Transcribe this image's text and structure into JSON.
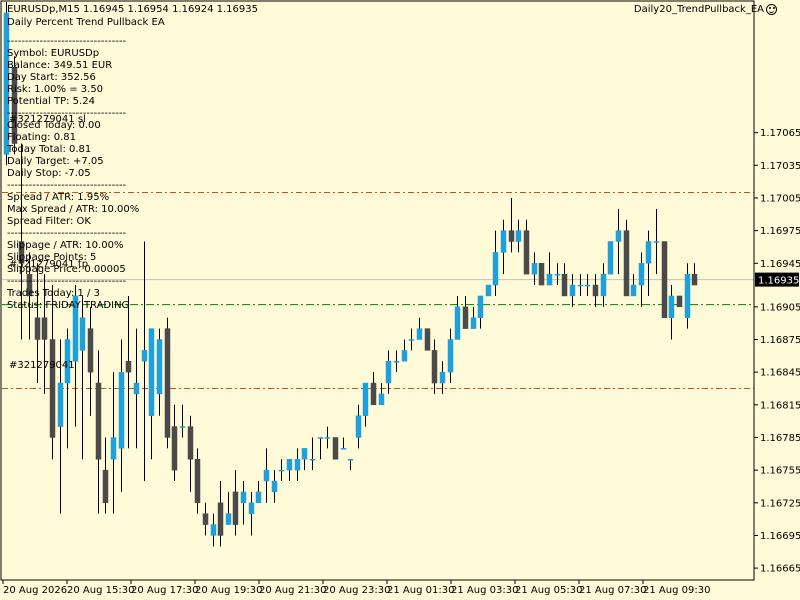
{
  "header": {
    "symbol_line": "EURUSDp,M15  1.16945 1.16954 1.16924 1.16935",
    "ea_title": "Daily Percent Trend Pullback EA"
  },
  "expert": {
    "name": "Daily20_TrendPullback_EA",
    "status_icon": "smiley-icon"
  },
  "panel": {
    "separator": "---------------------------------",
    "group1": [
      "Symbol: EURUSDp",
      "Balance: 349.51 EUR",
      "Day Start: 352.56",
      "Risk: 1.00% = 3.50",
      "Potential TP: 5.24"
    ],
    "group2": [
      "Closed Today: 0.00",
      "Floating: 0.81",
      "Today Total: 0.81",
      "Daily Target: +7.05",
      "Daily Stop: -7.05"
    ],
    "group3": [
      "Spread / ATR: 1.95%",
      "Max Spread / ATR: 10.00%",
      "Spread Filter: OK"
    ],
    "group4": [
      "Slippage / ATR: 10.00%",
      "Slippage Points: 5",
      "Slippage Price: 0.00005"
    ],
    "group5": [
      "Trades Today: 1 / 3",
      "Status: FRIDAY TRADING"
    ]
  },
  "overlays": {
    "ticket_upper": "#321279041 sl",
    "ticket_lower": "#321279041",
    "ticket_mid": "#321279041 tp"
  },
  "colors": {
    "background": "#fffbd8",
    "bull": "#1ea0dc",
    "bear": "#4a4a4a",
    "grid_price_line": "#c0c0c0",
    "stop_line": "#c8501e",
    "entry_line": "#008000",
    "current_price_bg": "#000000"
  },
  "chart_data": {
    "type": "candlestick",
    "symbol": "EURUSDp",
    "timeframe": "M15",
    "ylim": [
      1.1666,
      1.1719
    ],
    "yticks": [
      "1.17065",
      "1.17035",
      "1.17005",
      "1.16975",
      "1.16945",
      "1.16905",
      "1.16875",
      "1.16845",
      "1.16815",
      "1.16785",
      "1.16755",
      "1.16725",
      "1.16695",
      "1.16665"
    ],
    "ytick_values": [
      1.1707,
      1.1704,
      1.1701,
      1.1698,
      1.1695,
      1.1691,
      1.1688,
      1.1685,
      1.1682,
      1.1679,
      1.1676,
      1.1673,
      1.167,
      1.1667
    ],
    "xticks": [
      "20 Aug 2026",
      "20 Aug 15:30",
      "20 Aug 17:30",
      "20 Aug 19:30",
      "20 Aug 21:30",
      "20 Aug 23:30",
      "21 Aug 01:30",
      "21 Aug 03:30",
      "21 Aug 05:30",
      "21 Aug 07:30",
      "21 Aug 09:30"
    ],
    "current_price": "1.16935",
    "current_price_value": 1.16935,
    "levels": {
      "stop_upper": 1.17015,
      "stop_lower": 1.16835,
      "entry": 1.16912,
      "current": 1.16935
    },
    "candles": [
      [
        1.1705,
        1.1719,
        1.1704,
        1.1718
      ],
      [
        1.1713,
        1.1714,
        1.1705,
        1.1706
      ],
      [
        1.1697,
        1.1706,
        1.1688,
        1.1695
      ],
      [
        1.1694,
        1.1696,
        1.1688,
        1.1692
      ],
      [
        1.169,
        1.1695,
        1.1684,
        1.1688
      ],
      [
        1.169,
        1.1694,
        1.1683,
        1.1688
      ],
      [
        1.1688,
        1.1693,
        1.1677,
        1.1679
      ],
      [
        1.168,
        1.1688,
        1.1672,
        1.1684
      ],
      [
        1.1684,
        1.1689,
        1.1678,
        1.1688
      ],
      [
        1.1686,
        1.1693,
        1.168,
        1.1692
      ],
      [
        1.1687,
        1.1692,
        1.1677,
        1.169
      ],
      [
        1.1689,
        1.1691,
        1.1681,
        1.1685
      ],
      [
        1.1684,
        1.1687,
        1.1672,
        1.1677
      ],
      [
        1.1676,
        1.1679,
        1.1672,
        1.1673
      ],
      [
        1.1677,
        1.1685,
        1.1672,
        1.1679
      ],
      [
        1.1678,
        1.1688,
        1.1674,
        1.1685
      ],
      [
        1.1686,
        1.1692,
        1.1678,
        1.1685
      ],
      [
        1.1683,
        1.1689,
        1.1678,
        1.1684
      ],
      [
        1.1686,
        1.1697,
        1.1675,
        1.1687
      ],
      [
        1.1681,
        1.1689,
        1.1677,
        1.1689
      ],
      [
        1.1683,
        1.1689,
        1.1681,
        1.1688
      ],
      [
        1.1689,
        1.169,
        1.1678,
        1.1679
      ],
      [
        1.168,
        1.1682,
        1.1675,
        1.1676
      ],
      [
        1.168,
        1.1682,
        1.1679,
        1.168
      ],
      [
        1.168,
        1.1681,
        1.1674,
        1.1677
      ],
      [
        1.1677,
        1.1678,
        1.1672,
        1.1673
      ],
      [
        1.1672,
        1.1673,
        1.167,
        1.1671
      ],
      [
        1.167,
        1.1672,
        1.1669,
        1.1671
      ],
      [
        1.1673,
        1.1675,
        1.1669,
        1.167
      ],
      [
        1.1671,
        1.1674,
        1.1671,
        1.1672
      ],
      [
        1.1674,
        1.1676,
        1.167,
        1.1671
      ],
      [
        1.1673,
        1.1675,
        1.1671,
        1.1674
      ],
      [
        1.1672,
        1.1674,
        1.167,
        1.1673
      ],
      [
        1.1673,
        1.1675,
        1.1673,
        1.1674
      ],
      [
        1.1675,
        1.1678,
        1.1673,
        1.1676
      ],
      [
        1.1674,
        1.1676,
        1.1673,
        1.1675
      ],
      [
        1.1676,
        1.1677,
        1.1675,
        1.1676
      ],
      [
        1.1676,
        1.1677,
        1.1675,
        1.1677
      ],
      [
        1.1676,
        1.1678,
        1.1675,
        1.1677
      ],
      [
        1.1677,
        1.1678,
        1.1676,
        1.1678
      ],
      [
        1.1677,
        1.1679,
        1.1676,
        1.1677
      ],
      [
        1.1679,
        1.1679,
        1.1677,
        1.1679
      ],
      [
        1.1679,
        1.168,
        1.1678,
        1.1679
      ],
      [
        1.1679,
        1.1679,
        1.1677,
        1.1677
      ],
      [
        1.1678,
        1.1679,
        1.1678,
        1.1678
      ],
      [
        1.1677,
        1.1677,
        1.1676,
        1.1677
      ],
      [
        1.1679,
        1.1682,
        1.1678,
        1.1681
      ],
      [
        1.1681,
        1.1684,
        1.168,
        1.1684
      ],
      [
        1.1684,
        1.1685,
        1.1682,
        1.1682
      ],
      [
        1.1682,
        1.1684,
        1.1682,
        1.1683
      ],
      [
        1.1684,
        1.1687,
        1.1683,
        1.1686
      ],
      [
        1.1686,
        1.1687,
        1.1685,
        1.1686
      ],
      [
        1.1686,
        1.1688,
        1.1686,
        1.1687
      ],
      [
        1.1688,
        1.1689,
        1.1687,
        1.1688
      ],
      [
        1.1688,
        1.169,
        1.1688,
        1.1689
      ],
      [
        1.1689,
        1.1689,
        1.1687,
        1.1687
      ],
      [
        1.1687,
        1.1688,
        1.1683,
        1.1684
      ],
      [
        1.1684,
        1.1686,
        1.1683,
        1.1685
      ],
      [
        1.1685,
        1.1689,
        1.1684,
        1.1688
      ],
      [
        1.1688,
        1.1692,
        1.1688,
        1.1691
      ],
      [
        1.1691,
        1.1692,
        1.1689,
        1.1689
      ],
      [
        1.1689,
        1.1691,
        1.1689,
        1.169
      ],
      [
        1.169,
        1.1692,
        1.1689,
        1.1692
      ],
      [
        1.1692,
        1.1693,
        1.1692,
        1.1693
      ],
      [
        1.1693,
        1.1698,
        1.1692,
        1.1696
      ],
      [
        1.1696,
        1.1699,
        1.1694,
        1.1698
      ],
      [
        1.1698,
        1.1701,
        1.1696,
        1.1697
      ],
      [
        1.1697,
        1.1699,
        1.1696,
        1.1698
      ],
      [
        1.1698,
        1.1699,
        1.1694,
        1.1694
      ],
      [
        1.1694,
        1.1696,
        1.1693,
        1.1695
      ],
      [
        1.1695,
        1.1695,
        1.1693,
        1.1693
      ],
      [
        1.1693,
        1.1696,
        1.1693,
        1.1694
      ],
      [
        1.1694,
        1.1695,
        1.1693,
        1.1694
      ],
      [
        1.1694,
        1.1695,
        1.1692,
        1.1692
      ],
      [
        1.1692,
        1.1694,
        1.1691,
        1.1693
      ],
      [
        1.1693,
        1.1694,
        1.1692,
        1.1693
      ],
      [
        1.1693,
        1.1694,
        1.1692,
        1.1693
      ],
      [
        1.1693,
        1.1694,
        1.1691,
        1.1692
      ],
      [
        1.1692,
        1.1695,
        1.1691,
        1.1694
      ],
      [
        1.1694,
        1.1697,
        1.1694,
        1.1697
      ],
      [
        1.1697,
        1.17,
        1.1694,
        1.1698
      ],
      [
        1.1698,
        1.1699,
        1.1692,
        1.1692
      ],
      [
        1.1692,
        1.1694,
        1.1692,
        1.1693
      ],
      [
        1.1693,
        1.1696,
        1.1691,
        1.1695
      ],
      [
        1.1695,
        1.1698,
        1.1692,
        1.1697
      ],
      [
        1.1697,
        1.17,
        1.1694,
        1.1697
      ],
      [
        1.1697,
        1.1697,
        1.169,
        1.169
      ],
      [
        1.169,
        1.1693,
        1.1688,
        1.1692
      ],
      [
        1.1692,
        1.1692,
        1.1691,
        1.1691
      ],
      [
        1.169,
        1.1695,
        1.1689,
        1.1694
      ],
      [
        1.1694,
        1.1695,
        1.1693,
        1.1693
      ]
    ]
  }
}
